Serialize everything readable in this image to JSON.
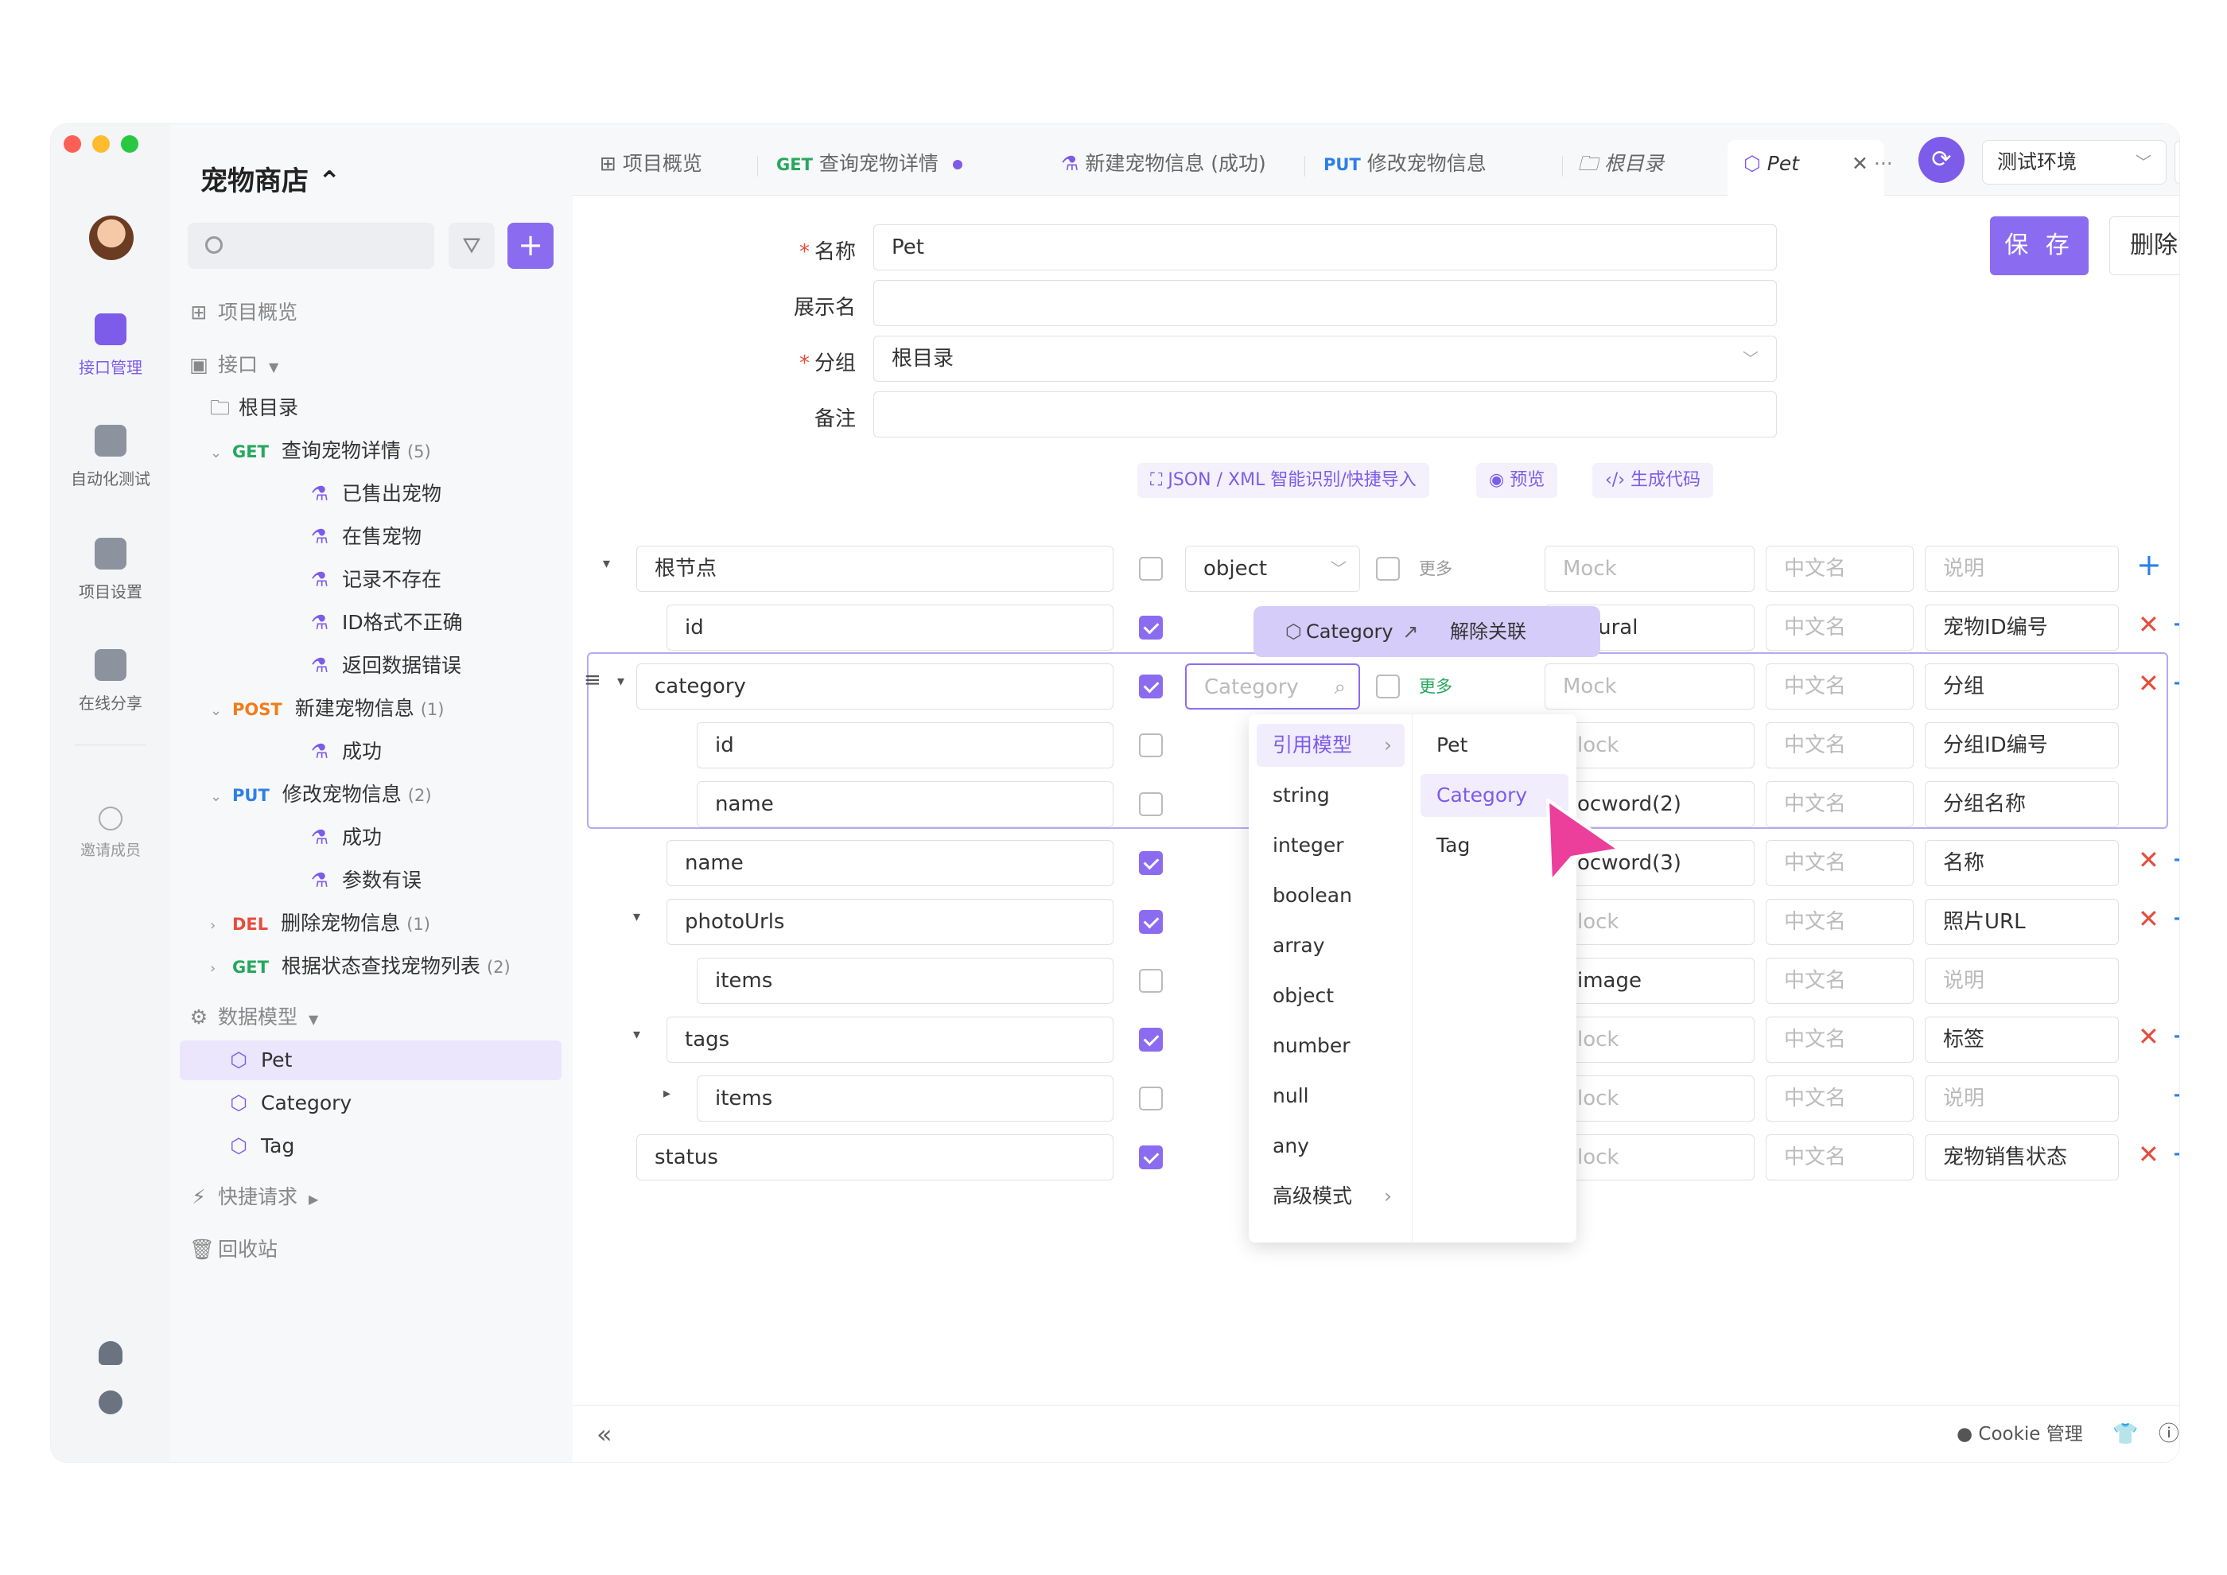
{
  "rail": {
    "items": [
      {
        "label": "接口管理",
        "icon": "api-icon",
        "active": true
      },
      {
        "label": "自动化测试",
        "icon": "automation-icon",
        "active": false
      },
      {
        "label": "项目设置",
        "icon": "settings-panel-icon",
        "active": false
      },
      {
        "label": "在线分享",
        "icon": "share-icon",
        "active": false
      }
    ],
    "invite": "邀请成员"
  },
  "sidebar": {
    "project_title": "宠物商店 ⌃",
    "tree": [
      {
        "label": "项目概览",
        "type": "nav"
      },
      {
        "label": "接口",
        "type": "nav"
      },
      {
        "label": "根目录",
        "type": "folder"
      },
      {
        "method": "GET",
        "label": "查询宠物详情",
        "count": "(5)"
      },
      {
        "label": "已售出宠物",
        "type": "case"
      },
      {
        "label": "在售宠物",
        "type": "case"
      },
      {
        "label": "记录不存在",
        "type": "case"
      },
      {
        "label": "ID格式不正确",
        "type": "case"
      },
      {
        "label": "返回数据错误",
        "type": "case"
      },
      {
        "method": "POST",
        "label": "新建宠物信息",
        "count": "(1)"
      },
      {
        "label": "成功",
        "type": "case"
      },
      {
        "method": "PUT",
        "label": "修改宠物信息",
        "count": "(2)"
      },
      {
        "label": "成功",
        "type": "case"
      },
      {
        "label": "参数有误",
        "type": "case"
      },
      {
        "method": "DEL",
        "label": "删除宠物信息",
        "count": "(1)"
      },
      {
        "method": "GET",
        "label": "根据状态查找宠物列表",
        "count": "(2)"
      },
      {
        "label": "数据模型",
        "type": "nav"
      },
      {
        "label": "Pet",
        "type": "model"
      },
      {
        "label": "Category",
        "type": "model"
      },
      {
        "label": "Tag",
        "type": "model"
      },
      {
        "label": "快捷请求",
        "type": "nav"
      },
      {
        "label": "回收站",
        "type": "nav"
      }
    ]
  },
  "tabs": [
    {
      "label": "项目概览"
    },
    {
      "method": "GET",
      "label": "查询宠物详情"
    },
    {
      "label": "新建宠物信息 (成功)"
    },
    {
      "method": "PUT",
      "label": "修改宠物信息"
    },
    {
      "label": "根目录"
    },
    {
      "label": "Pet"
    }
  ],
  "topbar": {
    "more": "···",
    "env": "测试环境",
    "sync_icon": "sync-icon"
  },
  "form": {
    "name_label": "名称",
    "name_value": "Pet",
    "display_label": "展示名",
    "display_value": "",
    "group_label": "分组",
    "group_value": "根目录",
    "note_label": "备注",
    "note_value": "",
    "save": "保 存",
    "delete": "删除",
    "tools": [
      "JSON / XML 智能识别/快捷导入",
      "预览",
      "生成代码"
    ]
  },
  "schema": {
    "placeholders": {
      "mock": "Mock",
      "cn": "中文名",
      "desc": "说明",
      "type": "Category"
    },
    "more": "更多",
    "rows": [
      {
        "name": "根节点",
        "type": "object",
        "mock": "",
        "cn": "",
        "desc": "",
        "checked": false
      },
      {
        "name": "id",
        "type": "",
        "mock": "atural",
        "cn": "",
        "desc": "宠物ID编号",
        "checked": true
      },
      {
        "name": "category",
        "type": "",
        "mock": "",
        "cn": "",
        "desc": "分组",
        "checked": true
      },
      {
        "name": "id",
        "type": "",
        "mock": "lock",
        "cn": "",
        "desc": "分组ID编号",
        "checked": false
      },
      {
        "name": "name",
        "type": "",
        "mock": "ocword(2)",
        "cn": "",
        "desc": "分组名称",
        "checked": false
      },
      {
        "name": "name",
        "type": "",
        "mock": "ocword(3)",
        "cn": "",
        "desc": "名称",
        "checked": true
      },
      {
        "name": "photoUrls",
        "type": "",
        "mock": "lock",
        "cn": "",
        "desc": "照片URL",
        "checked": true
      },
      {
        "name": "items",
        "type": "",
        "mock": "image",
        "cn": "",
        "desc": "",
        "checked": false
      },
      {
        "name": "tags",
        "type": "",
        "mock": "lock",
        "cn": "",
        "desc": "标签",
        "checked": true
      },
      {
        "name": "items",
        "type": "",
        "mock": "lock",
        "cn": "",
        "desc": "",
        "checked": false
      },
      {
        "name": "status",
        "type": "",
        "mock": "lock",
        "cn": "",
        "desc": "宠物销售状态",
        "checked": true
      }
    ]
  },
  "popover": {
    "ref_name": "Category",
    "unlink": "解除关联"
  },
  "dropdown": {
    "types": [
      "引用模型",
      "string",
      "integer",
      "boolean",
      "array",
      "object",
      "number",
      "null",
      "any",
      "高级模式"
    ],
    "models": [
      "Pet",
      "Category",
      "Tag"
    ]
  },
  "statusbar": {
    "cookie": "Cookie 管理"
  },
  "colors": {
    "accent": "#8b6cf0",
    "get": "#26a85d",
    "post": "#f07d1a",
    "put": "#2d7fe8",
    "del": "#e74c3c"
  }
}
